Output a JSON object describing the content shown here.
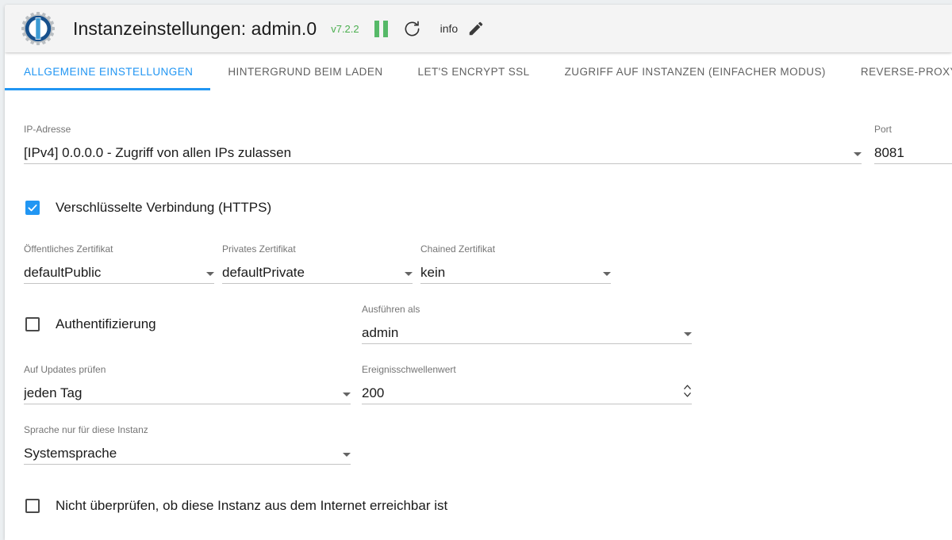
{
  "header": {
    "logo_icon": "iobroker-gear-logo",
    "title": "Instanzeinstellungen: admin.0",
    "version": "v7.2.2",
    "pause_icon": "pause-icon",
    "refresh_icon": "refresh-icon",
    "info_label": "info",
    "edit_icon": "pencil-edit-icon",
    "accent_color": "#2196f3",
    "version_color": "#4caf50",
    "pause_color": "#56b968"
  },
  "tabs": [
    {
      "label": "ALLGEMEINE EINSTELLUNGEN",
      "active": true
    },
    {
      "label": "HINTERGRUND BEIM LADEN",
      "active": false
    },
    {
      "label": "LET'S ENCRYPT SSL",
      "active": false
    },
    {
      "label": "ZUGRIFF AUF INSTANZEN (EINFACHER MODUS)",
      "active": false
    },
    {
      "label": "REVERSE-PROXY",
      "active": false
    }
  ],
  "form": {
    "ip_address": {
      "label": "IP-Adresse",
      "value": "[IPv4] 0.0.0.0 - Zugriff von allen IPs zulassen"
    },
    "port": {
      "label": "Port",
      "value": "8081"
    },
    "https": {
      "label": "Verschlüsselte Verbindung (HTTPS)",
      "checked": true
    },
    "public_cert": {
      "label": "Öffentliches Zertifikat",
      "value": "defaultPublic"
    },
    "private_cert": {
      "label": "Privates Zertifikat",
      "value": "defaultPrivate"
    },
    "chained_cert": {
      "label": "Chained Zertifikat",
      "value": "kein"
    },
    "authentication": {
      "label": "Authentifizierung",
      "checked": false
    },
    "run_as": {
      "label": "Ausführen als",
      "value": "admin"
    },
    "check_updates": {
      "label": "Auf Updates prüfen",
      "value": "jeden Tag"
    },
    "event_threshold": {
      "label": "Ereignisschwellenwert",
      "value": "200"
    },
    "instance_language": {
      "label": "Sprache nur für diese Instanz",
      "value": "Systemsprache"
    },
    "no_internet_check": {
      "label": "Nicht überprüfen, ob diese Instanz aus dem Internet erreichbar ist",
      "checked": false
    }
  }
}
